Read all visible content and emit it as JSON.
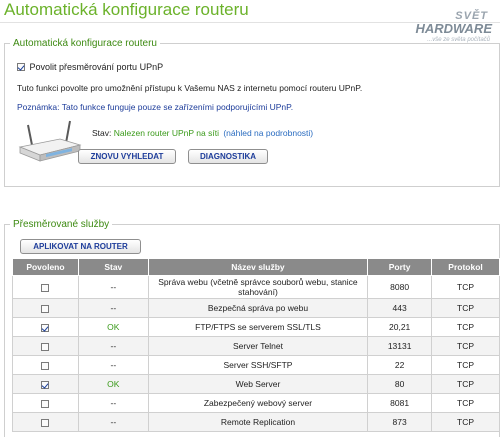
{
  "header": {
    "title": "Automatická konfigurace routeru",
    "logo_line1": "SVĚT",
    "logo_line2": "HARDWARE",
    "logo_line3": "...vše ze světa počítačů"
  },
  "upnp_section": {
    "legend": "Automatická konfigurace routeru",
    "enable_label": "Povolit přesměrování portu UPnP",
    "enable_checked": true,
    "description": "Tuto funkci povolte pro umožnění přístupu k Vašemu NAS z internetu pomocí routeru UPnP.",
    "note": "Poznámka: Tato funkce funguje pouze se zařízeními podporujícími UPnP.",
    "status_label": "Stav:",
    "status_value": "Nalezen router UPnP na síti",
    "status_link": "(náhled na podrobnosti)",
    "rescan_button": "ZNOVU VYHLEDAT",
    "diagnostics_button": "DIAGNOSTIKA"
  },
  "services_section": {
    "legend": "Přesměrované služby",
    "apply_button": "APLIKOVAT NA ROUTER",
    "columns": [
      "Povoleno",
      "Stav",
      "Název služby",
      "Porty",
      "Protokol"
    ],
    "rows": [
      {
        "enabled": false,
        "status": "--",
        "name": "Správa webu (včetně správce souborů webu, stanice stahování)",
        "ports": "8080",
        "protocol": "TCP"
      },
      {
        "enabled": false,
        "status": "--",
        "name": "Bezpečná správa po webu",
        "ports": "443",
        "protocol": "TCP"
      },
      {
        "enabled": true,
        "status": "OK",
        "name": "FTP/FTPS se serverem SSL/TLS",
        "ports": "20,21",
        "protocol": "TCP"
      },
      {
        "enabled": false,
        "status": "--",
        "name": "Server Telnet",
        "ports": "13131",
        "protocol": "TCP"
      },
      {
        "enabled": false,
        "status": "--",
        "name": "Server SSH/SFTP",
        "ports": "22",
        "protocol": "TCP"
      },
      {
        "enabled": true,
        "status": "OK",
        "name": "Web Server",
        "ports": "80",
        "protocol": "TCP"
      },
      {
        "enabled": false,
        "status": "--",
        "name": "Zabezpečený webový server",
        "ports": "8081",
        "protocol": "TCP"
      },
      {
        "enabled": false,
        "status": "--",
        "name": "Remote Replication",
        "ports": "873",
        "protocol": "TCP"
      }
    ]
  }
}
